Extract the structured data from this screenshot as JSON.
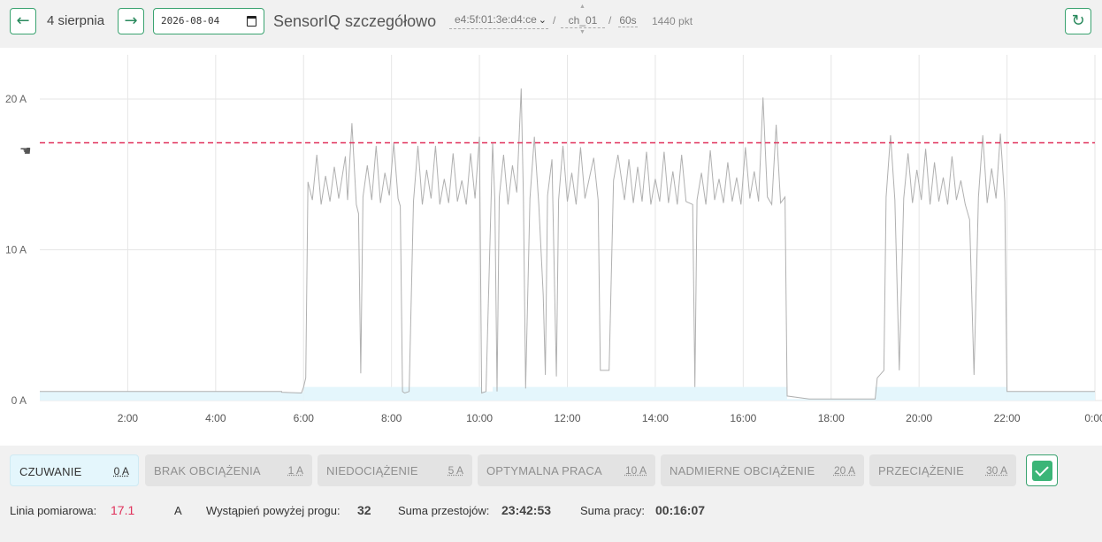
{
  "header": {
    "prev_label": "←",
    "next_label": "→",
    "date_label": "4 sierpnia",
    "date_value": "2026-08-04",
    "title": "SensorIQ szczegółowo",
    "device": "e4:5f:01:3e:d4:ce",
    "separator": "/",
    "channel": "ch_01",
    "interval": "60s",
    "points": "1440 pkt",
    "refresh_label": "↻"
  },
  "chart_data": {
    "type": "line",
    "x_unit": "hour",
    "y_unit": "A",
    "ylim": [
      0,
      20
    ],
    "xlim": [
      0,
      24
    ],
    "yticks": [
      "0 A",
      "10 A",
      "20 A"
    ],
    "yticks_values": [
      0,
      10,
      20
    ],
    "xticks": [
      "2:00",
      "4:00",
      "6:00",
      "8:00",
      "10:00",
      "12:00",
      "14:00",
      "16:00",
      "18:00",
      "20:00",
      "22:00",
      "0:00"
    ],
    "xticks_values": [
      2,
      4,
      6,
      8,
      10,
      12,
      14,
      16,
      18,
      20,
      22,
      24
    ],
    "threshold": 17.1,
    "threshold_color": "#e0305a",
    "line_color": "#b0b0b0",
    "fill_color": "#e4f6fc",
    "grid": true,
    "series": [
      {
        "values": [
          [
            0,
            0.6
          ],
          [
            5.5,
            0.6
          ],
          [
            5.5,
            0.55
          ],
          [
            5.95,
            0.5
          ],
          [
            6.0,
            0.9
          ],
          [
            6.05,
            1.5
          ],
          [
            6.1,
            14.5
          ],
          [
            6.2,
            13.3
          ],
          [
            6.3,
            16.3
          ],
          [
            6.4,
            13.0
          ],
          [
            6.5,
            14.9
          ],
          [
            6.6,
            13.2
          ],
          [
            6.7,
            15.5
          ],
          [
            6.8,
            13.4
          ],
          [
            6.95,
            16.2
          ],
          [
            7.0,
            13.3
          ],
          [
            7.1,
            18.4
          ],
          [
            7.2,
            13.0
          ],
          [
            7.25,
            12.4
          ],
          [
            7.3,
            1.8
          ],
          [
            7.35,
            13.5
          ],
          [
            7.45,
            15.6
          ],
          [
            7.55,
            13.3
          ],
          [
            7.65,
            16.9
          ],
          [
            7.75,
            13.1
          ],
          [
            7.85,
            15.1
          ],
          [
            7.95,
            13.6
          ],
          [
            8.05,
            17.1
          ],
          [
            8.15,
            13.4
          ],
          [
            8.2,
            12.9
          ],
          [
            8.25,
            0.6
          ],
          [
            8.3,
            0.5
          ],
          [
            8.4,
            0.6
          ],
          [
            8.5,
            13.2
          ],
          [
            8.6,
            16.9
          ],
          [
            8.7,
            13.0
          ],
          [
            8.8,
            15.3
          ],
          [
            8.9,
            13.4
          ],
          [
            9.0,
            16.9
          ],
          [
            9.1,
            13.0
          ],
          [
            9.2,
            14.7
          ],
          [
            9.3,
            13.1
          ],
          [
            9.4,
            16.4
          ],
          [
            9.5,
            13.2
          ],
          [
            9.6,
            14.6
          ],
          [
            9.7,
            13.0
          ],
          [
            9.8,
            16.4
          ],
          [
            9.9,
            13.4
          ],
          [
            10.0,
            17.5
          ],
          [
            10.05,
            0.5
          ],
          [
            10.15,
            0.6
          ],
          [
            10.3,
            17.1
          ],
          [
            10.35,
            13.3
          ],
          [
            10.4,
            0.6
          ],
          [
            10.45,
            13.5
          ],
          [
            10.55,
            16.3
          ],
          [
            10.65,
            13.0
          ],
          [
            10.75,
            15.6
          ],
          [
            10.85,
            13.8
          ],
          [
            10.95,
            20.7
          ],
          [
            11.0,
            13.5
          ],
          [
            11.05,
            0.8
          ],
          [
            11.15,
            13.4
          ],
          [
            11.25,
            17.5
          ],
          [
            11.35,
            13.0
          ],
          [
            11.45,
            7.0
          ],
          [
            11.5,
            1.7
          ],
          [
            11.55,
            13.6
          ],
          [
            11.65,
            16.0
          ],
          [
            11.75,
            1.6
          ],
          [
            11.8,
            13.3
          ],
          [
            11.9,
            16.9
          ],
          [
            12.0,
            13.2
          ],
          [
            12.1,
            15.1
          ],
          [
            12.2,
            13.0
          ],
          [
            12.3,
            16.8
          ],
          [
            12.4,
            13.4
          ],
          [
            12.6,
            16.1
          ],
          [
            12.7,
            13.3
          ],
          [
            12.75,
            2.0
          ],
          [
            12.95,
            2.0
          ],
          [
            13.05,
            14.6
          ],
          [
            13.15,
            16.3
          ],
          [
            13.3,
            13.3
          ],
          [
            13.4,
            16.0
          ],
          [
            13.5,
            13.1
          ],
          [
            13.6,
            15.5
          ],
          [
            13.7,
            13.2
          ],
          [
            13.8,
            16.5
          ],
          [
            13.9,
            13.0
          ],
          [
            14.0,
            14.7
          ],
          [
            14.1,
            13.2
          ],
          [
            14.2,
            16.5
          ],
          [
            14.3,
            13.1
          ],
          [
            14.4,
            15.2
          ],
          [
            14.5,
            13.0
          ],
          [
            14.6,
            16.3
          ],
          [
            14.7,
            13.2
          ],
          [
            14.85,
            13.0
          ],
          [
            14.9,
            0.9
          ],
          [
            14.95,
            13.3
          ],
          [
            15.05,
            15.1
          ],
          [
            15.15,
            13.0
          ],
          [
            15.25,
            16.6
          ],
          [
            15.35,
            13.3
          ],
          [
            15.45,
            14.7
          ],
          [
            15.55,
            13.1
          ],
          [
            15.65,
            15.8
          ],
          [
            15.75,
            13.2
          ],
          [
            15.85,
            14.8
          ],
          [
            15.95,
            13.0
          ],
          [
            16.05,
            16.8
          ],
          [
            16.15,
            13.4
          ],
          [
            16.25,
            15.2
          ],
          [
            16.35,
            13.2
          ],
          [
            16.45,
            20.1
          ],
          [
            16.55,
            13.5
          ],
          [
            16.65,
            13.0
          ],
          [
            16.75,
            18.3
          ],
          [
            16.85,
            13.1
          ],
          [
            16.95,
            13.5
          ],
          [
            17.0,
            0.3
          ],
          [
            17.5,
            0.1
          ],
          [
            18.5,
            0.1
          ],
          [
            19.0,
            0.1
          ],
          [
            19.05,
            1.5
          ],
          [
            19.2,
            2.0
          ],
          [
            19.25,
            13.5
          ],
          [
            19.35,
            17.6
          ],
          [
            19.45,
            13.3
          ],
          [
            19.55,
            2.0
          ],
          [
            19.65,
            13.4
          ],
          [
            19.75,
            16.4
          ],
          [
            19.85,
            13.1
          ],
          [
            19.95,
            15.3
          ],
          [
            20.05,
            13.3
          ],
          [
            20.15,
            16.7
          ],
          [
            20.25,
            13.0
          ],
          [
            20.35,
            15.8
          ],
          [
            20.45,
            13.2
          ],
          [
            20.55,
            14.8
          ],
          [
            20.65,
            13.0
          ],
          [
            20.75,
            16.2
          ],
          [
            20.85,
            13.3
          ],
          [
            20.95,
            14.6
          ],
          [
            21.05,
            13.0
          ],
          [
            21.15,
            12.0
          ],
          [
            21.25,
            1.7
          ],
          [
            21.35,
            13.5
          ],
          [
            21.45,
            17.6
          ],
          [
            21.55,
            13.1
          ],
          [
            21.65,
            15.4
          ],
          [
            21.75,
            13.4
          ],
          [
            21.85,
            17.7
          ],
          [
            21.95,
            13.2
          ],
          [
            22.0,
            0.6
          ],
          [
            22.5,
            0.6
          ],
          [
            24.0,
            0.6
          ]
        ]
      }
    ],
    "fill_levels": [
      [
        0,
        5.5,
        0.6
      ],
      [
        5.5,
        6.0,
        0.55
      ],
      [
        6.0,
        10.05,
        0.9
      ],
      [
        10.05,
        10.3,
        0.6
      ],
      [
        10.3,
        17.0,
        0.9
      ],
      [
        17.0,
        19.0,
        0.1
      ],
      [
        19.0,
        22.0,
        0.9
      ],
      [
        22.0,
        24.0,
        0.6
      ]
    ]
  },
  "legend": {
    "items": [
      {
        "name": "CZUWANIE",
        "value": "0 A",
        "active": true
      },
      {
        "name": "BRAK OBCIĄŻENIA",
        "value": "1 A",
        "active": false
      },
      {
        "name": "NIEDOCIĄŻENIE",
        "value": "5 A",
        "active": false
      },
      {
        "name": "OPTYMALNA PRACA",
        "value": "10 A",
        "active": false
      },
      {
        "name": "NADMIERNE OBCIĄŻENIE",
        "value": "20 A",
        "active": false
      },
      {
        "name": "PRZECIĄŻENIE",
        "value": "30 A",
        "active": false
      }
    ],
    "checkbox_checked": true
  },
  "stats": {
    "line_label": "Linia pomiarowa:",
    "line_value": "17.1",
    "line_unit": "A",
    "exceed_label": "Wystąpień powyżej progu:",
    "exceed_value": "32",
    "downtime_label": "Suma przestojów:",
    "downtime_value": "23:42:53",
    "work_label": "Suma pracy:",
    "work_value": "00:16:07"
  }
}
